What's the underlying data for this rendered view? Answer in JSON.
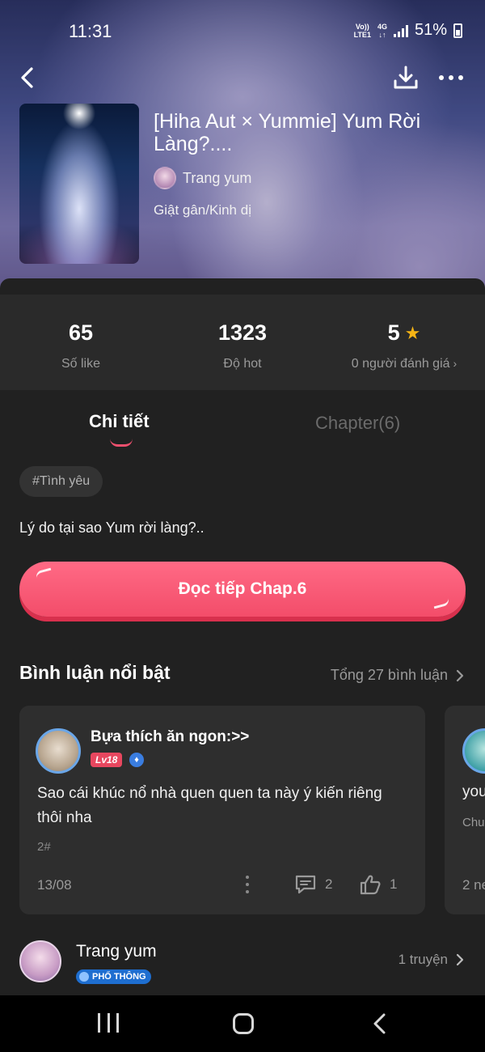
{
  "status_bar": {
    "time": "11:31",
    "network_top": "Vo))",
    "network_bottom": "LTE1",
    "data_top": "4G",
    "data_bottom": "↓↑",
    "battery": "51%"
  },
  "story": {
    "title": "[Hiha Aut × Yummie] Yum Rời Làng?....",
    "author": "Trang yum",
    "genre": "Giật gân/Kinh dị"
  },
  "stats": [
    {
      "value": "65",
      "label": "Số like"
    },
    {
      "value": "1323",
      "label": "Độ hot"
    },
    {
      "value": "5",
      "label": "0 người đánh giá"
    }
  ],
  "tabs": {
    "detail": "Chi tiết",
    "chapter": "Chapter(6)"
  },
  "tag": "#Tình yêu",
  "description": "Lý do tại sao Yum rời làng?..",
  "read_button": "Đọc tiếp Chap.6",
  "comments_section": {
    "title": "Bình luận nổi bật",
    "total": "Tổng 27 bình luận"
  },
  "comment": {
    "user": "Bựa thích ăn ngon:>>",
    "level": "Lv18",
    "text": "Sao cái khúc nổ nhà quen quen ta này ý kiến riêng thôi nha",
    "floor": "2#",
    "date": "13/08",
    "replies": "2",
    "likes": "1"
  },
  "comment2": {
    "text": "you",
    "sub": "Chu",
    "date": "2 ne"
  },
  "author_bar": {
    "name": "Trang yum",
    "badge": "PHỔ THÔNG",
    "stories": "1 truyện"
  },
  "colors": {
    "accent": "#f34d6a",
    "star": "#f6b415",
    "level_badge": "#e8475f",
    "vip_badge": "#1e6ed0"
  }
}
